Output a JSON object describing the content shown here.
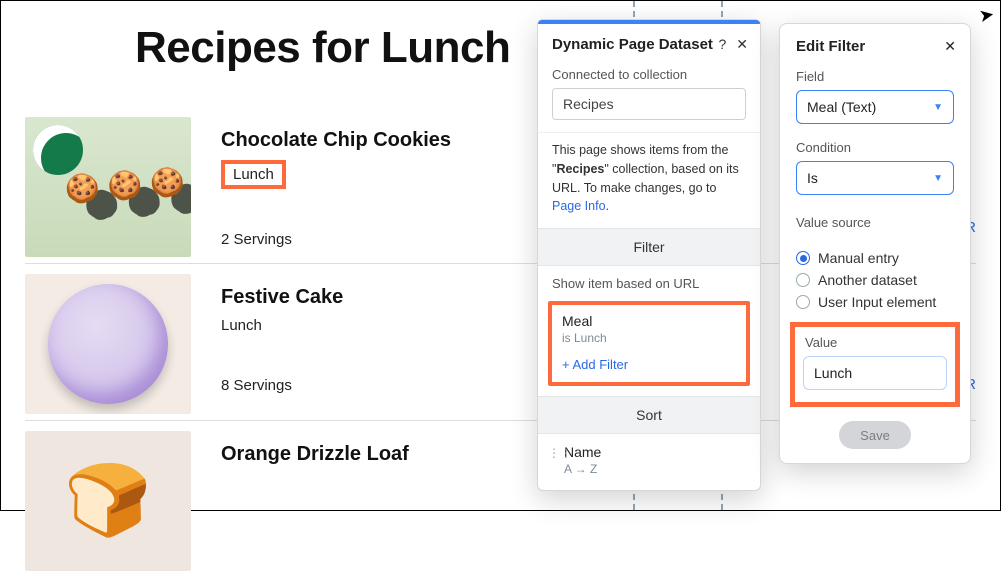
{
  "page": {
    "title": "Recipes for Lunch"
  },
  "recipes": [
    {
      "title": "Chocolate Chip Cookies",
      "meal": "Lunch",
      "servings": "2 Servings",
      "readmore": "R",
      "thumbClass": "cookies",
      "mealHighlighted": true
    },
    {
      "title": "Festive Cake",
      "meal": "Lunch",
      "servings": "8 Servings",
      "readmore": "R",
      "thumbClass": "cake",
      "mealHighlighted": false
    },
    {
      "title": "Orange Drizzle Loaf",
      "meal": "",
      "servings": "",
      "readmore": "",
      "thumbClass": "loaf",
      "mealHighlighted": false
    }
  ],
  "datasetPanel": {
    "title": "Dynamic Page Dataset",
    "help": "?",
    "close": "✕",
    "connectedLabel": "Connected to collection",
    "connectedValue": "Recipes",
    "infoPrefix": "This page shows items from the \"",
    "infoCollection": "Recipes",
    "infoMid": "\" collection, based on its URL. To make changes, go to ",
    "pageInfoLink": "Page Info",
    "infoSuffix": ".",
    "filterHeader": "Filter",
    "showItemLabel": "Show item based on URL",
    "filterFieldName": "Meal",
    "filterDesc": "is Lunch",
    "addFilter": "+ Add Filter",
    "sortHeader": "Sort",
    "sortField": "Name",
    "sortDir": "A → Z"
  },
  "editFilter": {
    "title": "Edit Filter",
    "close": "✕",
    "fieldLabel": "Field",
    "fieldValue": "Meal (Text)",
    "conditionLabel": "Condition",
    "conditionValue": "Is",
    "sourceLabel": "Value source",
    "sourceOptions": {
      "manual": "Manual entry",
      "dataset": "Another dataset",
      "userinput": "User Input element"
    },
    "valueLabel": "Value",
    "valueValue": "Lunch",
    "saveLabel": "Save"
  }
}
